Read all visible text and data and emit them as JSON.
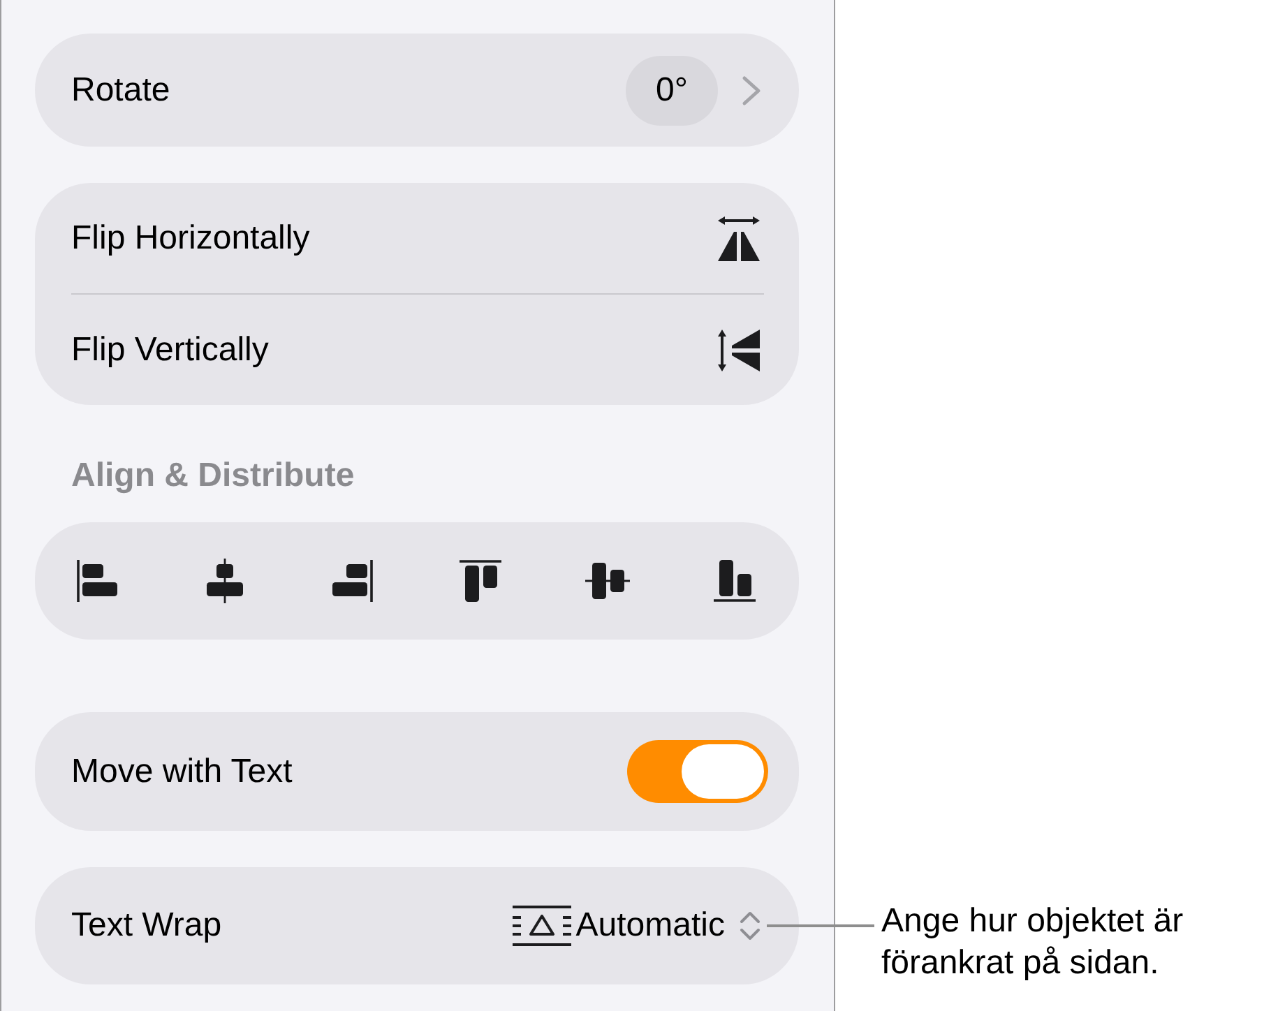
{
  "rotate": {
    "label": "Rotate",
    "value": "0°"
  },
  "flip": [
    {
      "label": "Flip Horizontally",
      "kind": "horizontal"
    },
    {
      "label": "Flip Vertically",
      "kind": "vertical"
    }
  ],
  "align": {
    "title": "Align & Distribute",
    "buttons": [
      {
        "kind": "left"
      },
      {
        "kind": "center"
      },
      {
        "kind": "right"
      },
      {
        "kind": "top"
      },
      {
        "kind": "middle"
      },
      {
        "kind": "bottom"
      }
    ]
  },
  "move_with_text": {
    "label": "Move with Text",
    "on": true
  },
  "text_wrap": {
    "label": "Text Wrap",
    "value": "Automatic"
  },
  "callout": {
    "text": "Ange hur objektet är förankrat på sidan."
  }
}
